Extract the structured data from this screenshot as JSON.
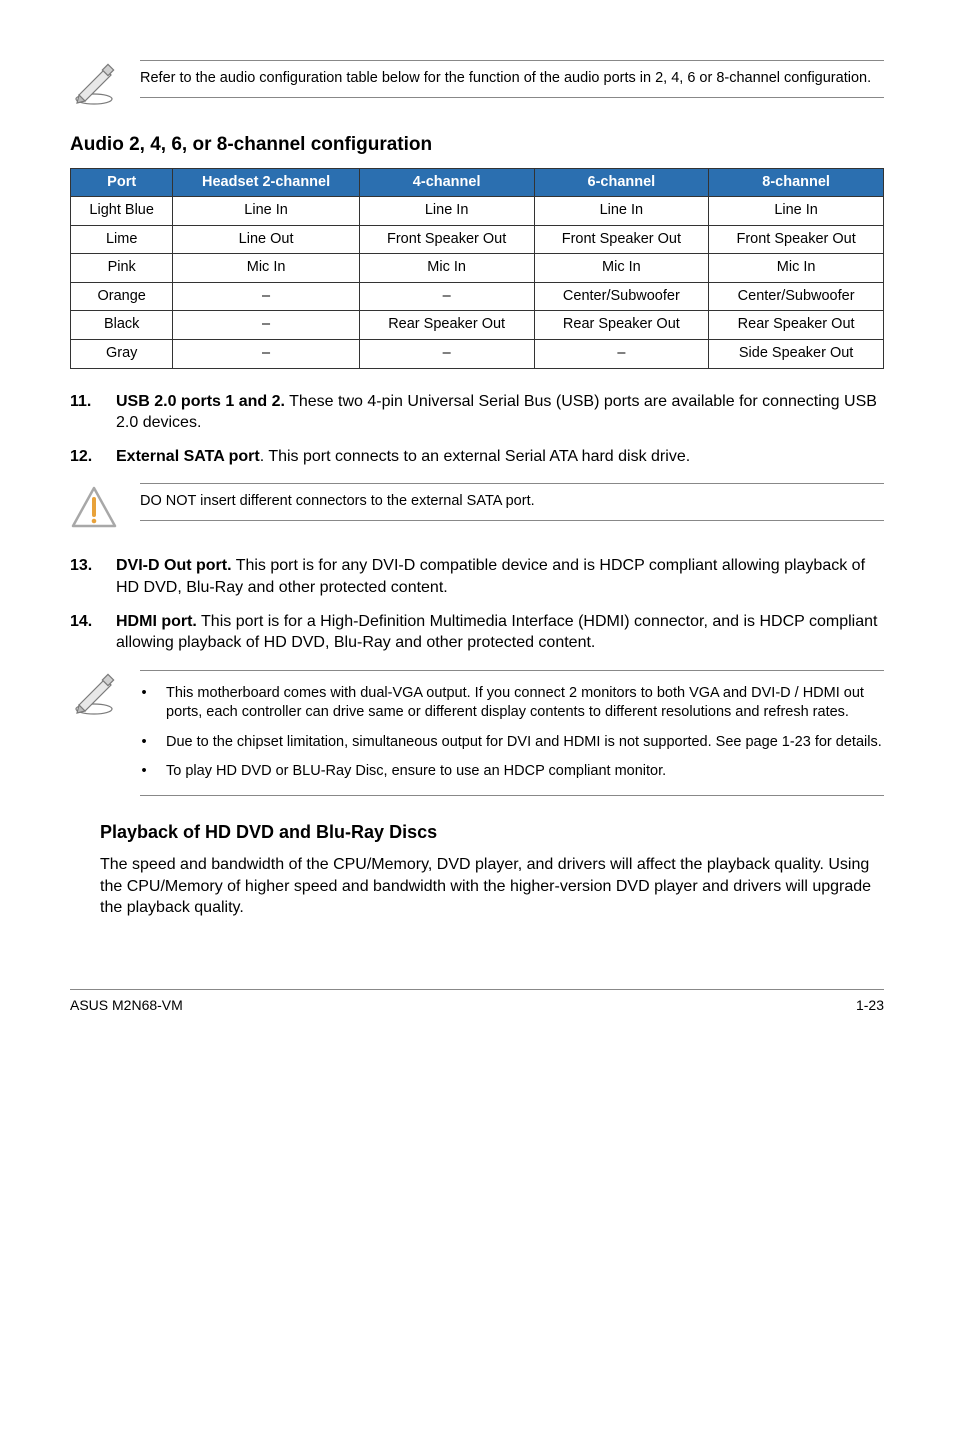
{
  "note1": {
    "text": "Refer to the audio configuration table below for the function of the audio ports in 2, 4, 6 or 8-channel configuration."
  },
  "section_title": "Audio 2, 4, 6, or 8-channel configuration",
  "table": {
    "headers": {
      "port": "Port",
      "headset": "Headset 2-channel",
      "ch4": "4-channel",
      "ch6": "6-channel",
      "ch8": "8-channel"
    },
    "rows": [
      {
        "port": "Light Blue",
        "h": "Line In",
        "c4": "Line In",
        "c6": "Line In",
        "c8": "Line In"
      },
      {
        "port": "Lime",
        "h": "Line Out",
        "c4": "Front Speaker Out",
        "c6": "Front Speaker Out",
        "c8": "Front Speaker Out"
      },
      {
        "port": "Pink",
        "h": "Mic In",
        "c4": "Mic In",
        "c6": "Mic In",
        "c8": "Mic In"
      },
      {
        "port": "Orange",
        "h": "–",
        "c4": "–",
        "c6": "Center/Subwoofer",
        "c8": "Center/Subwoofer"
      },
      {
        "port": "Black",
        "h": "–",
        "c4": "Rear Speaker Out",
        "c6": "Rear Speaker Out",
        "c8": "Rear Speaker Out"
      },
      {
        "port": "Gray",
        "h": "–",
        "c4": "–",
        "c6": "–",
        "c8": "Side Speaker Out"
      }
    ]
  },
  "list1": [
    {
      "num": "11.",
      "lead": "USB 2.0 ports 1 and 2.",
      "rest": " These two 4-pin Universal Serial Bus (USB) ports are available for connecting USB 2.0 devices."
    },
    {
      "num": "12.",
      "lead": "External SATA port",
      "rest": ". This port connects to an external Serial ATA hard disk drive."
    }
  ],
  "caution": {
    "text": "DO NOT insert different connectors to the external SATA port."
  },
  "list2": [
    {
      "num": "13.",
      "lead": "DVI-D Out port.",
      "rest": " This port is for any DVI-D compatible device and is HDCP compliant allowing playback of HD DVD, Blu-Ray and other protected content."
    },
    {
      "num": "14.",
      "lead": "HDMI port.",
      "rest": " This port is for a High-Definition Multimedia Interface (HDMI) connector, and is HDCP compliant allowing playback of HD DVD, Blu-Ray and other protected content."
    }
  ],
  "note2": {
    "bullets": [
      "This motherboard comes with dual-VGA output. If you connect 2 monitors to both VGA and DVI-D / HDMI out ports, each controller can drive same or different display contents to different resolutions and refresh rates.",
      "Due to the chipset limitation, simultaneous output for DVI and HDMI is not supported. See page 1-23 for details.",
      "To play HD DVD or BLU-Ray Disc, ensure to use an HDCP compliant monitor."
    ]
  },
  "sub_heading": "Playback of HD DVD and Blu-Ray Discs",
  "sub_body": "The speed and bandwidth of the CPU/Memory, DVD player, and drivers will affect the playback quality. Using the CPU/Memory of higher speed and bandwidth with the higher-version DVD player and drivers will upgrade the playback quality.",
  "footer": {
    "left": "ASUS M2N68-VM",
    "right": "1-23"
  }
}
